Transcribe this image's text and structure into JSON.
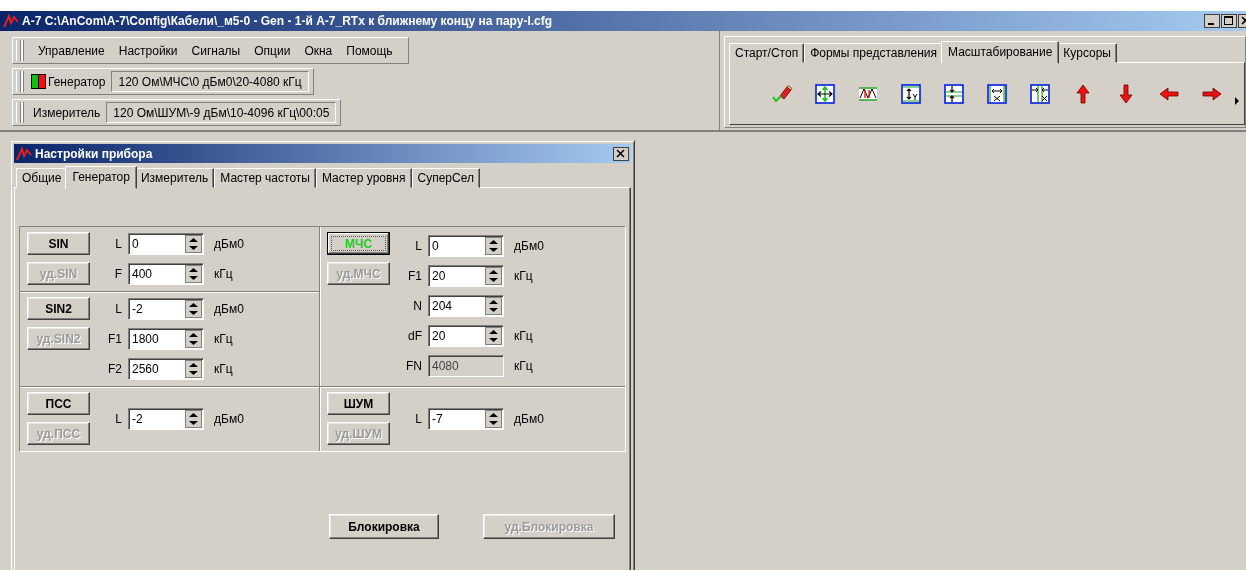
{
  "window": {
    "title": "A-7  C:\\AnCom\\A-7\\Config\\Кабели\\_м5-0 - Gen - 1-й A-7_RTx к ближнему концу на пару-I.cfg"
  },
  "menu": [
    "Управление",
    "Настройки",
    "Сигналы",
    "Опции",
    "Окна",
    "Помощь"
  ],
  "generator": {
    "label": "Генератор",
    "value": "120 Ом\\МЧС\\0 дБм0\\20-4080 кГц"
  },
  "meter": {
    "label": "Измеритель",
    "value": "120 Ом\\ШУМ\\-9 дБм\\10-4096 кГц\\00:05"
  },
  "view_tabs": [
    {
      "label": "Старт/Стоп",
      "selected": false
    },
    {
      "label": "Формы представления",
      "selected": false
    },
    {
      "label": "Масштабирование",
      "selected": true
    },
    {
      "label": "Курсоры",
      "selected": false
    }
  ],
  "dialog": {
    "title": "Настройки прибора",
    "tabs": [
      {
        "label": "Общие",
        "selected": false
      },
      {
        "label": "Генератор",
        "selected": true
      },
      {
        "label": "Измеритель",
        "selected": false
      },
      {
        "label": "Мастер частоты",
        "selected": false
      },
      {
        "label": "Мастер уровня",
        "selected": false
      },
      {
        "label": "СуперСел",
        "selected": false
      }
    ],
    "sections": [
      {
        "left": [
          {
            "buttons": [
              {
                "label": "SIN",
                "disabled": false,
                "active": false
              },
              {
                "label": "уд.SIN",
                "disabled": true,
                "active": false
              }
            ],
            "fields": [
              {
                "label": "L",
                "value": "0",
                "unit": "дБм0",
                "kind": "spin"
              },
              {
                "label": "F",
                "value": "400",
                "unit": "кГц",
                "kind": "spin"
              }
            ]
          },
          {
            "buttons": [
              {
                "label": "SIN2",
                "disabled": false,
                "active": false
              },
              {
                "label": "уд.SIN2",
                "disabled": true,
                "active": false
              }
            ],
            "fields": [
              {
                "label": "L",
                "value": "-2",
                "unit": "дБм0",
                "kind": "spin"
              },
              {
                "label": "F1",
                "value": "1800",
                "unit": "кГц",
                "kind": "spin"
              },
              {
                "label": "F2",
                "value": "2560",
                "unit": "кГц",
                "kind": "spin"
              }
            ]
          }
        ],
        "right": [
          {
            "buttons": [
              {
                "label": "МЧС",
                "disabled": false,
                "active": true
              },
              {
                "label": "уд.МЧС",
                "disabled": true,
                "active": false
              }
            ],
            "fields": [
              {
                "label": "L",
                "value": "0",
                "unit": "дБм0",
                "kind": "spin"
              },
              {
                "label": "F1",
                "value": "20",
                "unit": "кГц",
                "kind": "spin"
              },
              {
                "label": "N",
                "value": "204",
                "kind": "spin"
              },
              {
                "label": "dF",
                "value": "20",
                "unit": "кГц",
                "kind": "spin"
              },
              {
                "label": "FN",
                "value": "4080",
                "unit": "кГц",
                "kind": "readonly"
              }
            ]
          }
        ]
      },
      {
        "left": [
          {
            "buttons": [
              {
                "label": "ПСС",
                "disabled": false,
                "active": false
              },
              {
                "label": "уд.ПСС",
                "disabled": true,
                "active": false
              }
            ],
            "fields": [
              {
                "label": "L",
                "value": "-2",
                "unit": "дБм0",
                "kind": "spin"
              }
            ]
          }
        ],
        "right": [
          {
            "buttons": [
              {
                "label": "ШУМ",
                "disabled": false,
                "active": false
              },
              {
                "label": "уд.ШУМ",
                "disabled": true,
                "active": false
              }
            ],
            "fields": [
              {
                "label": "L",
                "value": "-7",
                "unit": "дБм0",
                "kind": "spin"
              }
            ]
          }
        ]
      }
    ],
    "buttons": [
      {
        "label": "Блокировка",
        "disabled": false
      },
      {
        "label": "уд.Блокировка",
        "disabled": true
      }
    ]
  }
}
